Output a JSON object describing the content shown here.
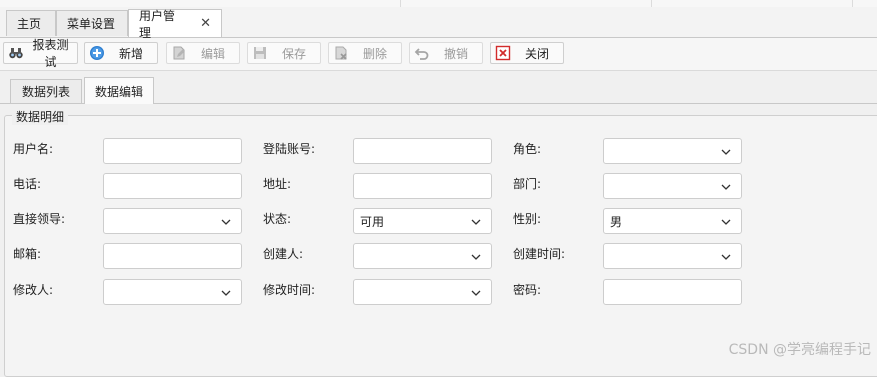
{
  "tabs": [
    {
      "label": "主页"
    },
    {
      "label": "菜单设置"
    },
    {
      "label": "用户管理"
    }
  ],
  "close_glyph": "✕",
  "toolbar": {
    "report_test": "报表测试",
    "add": "新增",
    "edit": "编辑",
    "save": "保存",
    "delete": "删除",
    "cancel": "撤销",
    "close": "关闭"
  },
  "subtabs": {
    "list": "数据列表",
    "edit": "数据编辑"
  },
  "group_title": "数据明细",
  "form": {
    "username_label": "用户名:",
    "account_label": "登陆账号:",
    "role_label": "角色:",
    "phone_label": "电话:",
    "address_label": "地址:",
    "department_label": "部门:",
    "leader_label": "直接领导:",
    "status_label": "状态:",
    "status_value": "可用",
    "gender_label": "性别:",
    "gender_value": "男",
    "email_label": "邮箱:",
    "creator_label": "创建人:",
    "create_time_label": "创建时间:",
    "modifier_label": "修改人:",
    "modify_time_label": "修改时间:",
    "password_label": "密码:"
  },
  "watermark": "CSDN @学亮编程手记",
  "icons": {
    "report": "binoculars-icon",
    "add": "plus-circle-icon",
    "edit": "pencil-icon",
    "save": "floppy-icon",
    "delete": "delete-icon",
    "cancel": "undo-icon",
    "close": "close-box-icon"
  },
  "colors": {
    "accent": "#2f7fd0",
    "close_red": "#d22b2b"
  }
}
